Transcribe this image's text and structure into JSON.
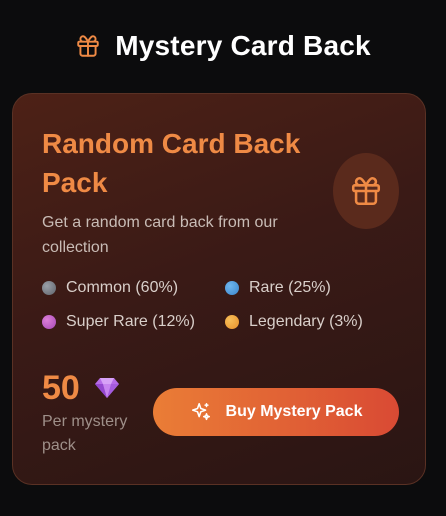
{
  "header": {
    "icon": "gift-icon",
    "title": "Mystery Card Back"
  },
  "card": {
    "title": "Random Card Back Pack",
    "icon": "gift-icon",
    "description": "Get a random card back from our collection",
    "rarities": [
      {
        "label": "Common (60%)",
        "color": "#7b7f88"
      },
      {
        "label": "Rare (25%)",
        "color": "#4b9ee0"
      },
      {
        "label": "Super Rare (12%)",
        "color": "#c25ec7"
      },
      {
        "label": "Legendary (3%)",
        "color": "#f0a23a"
      }
    ],
    "price": {
      "amount": "50",
      "currency_icon": "gem-icon",
      "note": "Per mystery pack"
    },
    "buy_button": {
      "icon": "sparkles-icon",
      "label": "Buy Mystery Pack"
    }
  },
  "colors": {
    "accent": "#ef8a45",
    "button_start": "#ea7d36",
    "button_end": "#d94a34"
  }
}
